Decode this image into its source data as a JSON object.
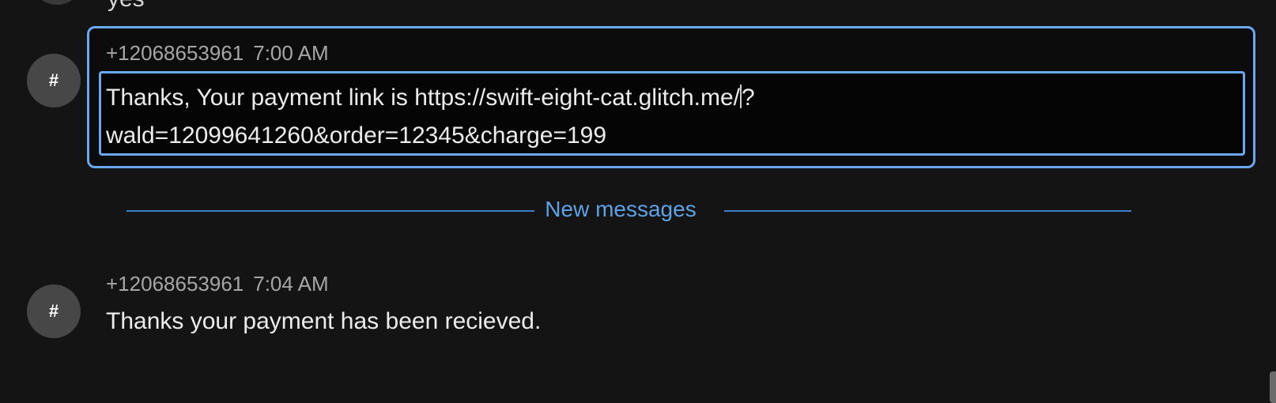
{
  "previous_message": {
    "text_fragment": "yes"
  },
  "messages": [
    {
      "avatar_glyph": "#",
      "sender": "+12068653961",
      "time": "7:00 AM",
      "line1": "Thanks, Your payment link is https://swift-eight-cat.glitch.me/",
      "line1_after_cursor": "?",
      "line2": "wald=12099641260&order=12345&charge=199",
      "selected": true
    },
    {
      "avatar_glyph": "#",
      "sender": "+12068653961",
      "time": "7:04 AM",
      "text": "Thanks your payment has been recieved.",
      "selected": false
    }
  ],
  "divider": {
    "label": "New messages"
  },
  "colors": {
    "background": "#141414",
    "accent": "#6aa9ef",
    "divider_text": "#5ea2e6",
    "avatar": "#474747"
  }
}
